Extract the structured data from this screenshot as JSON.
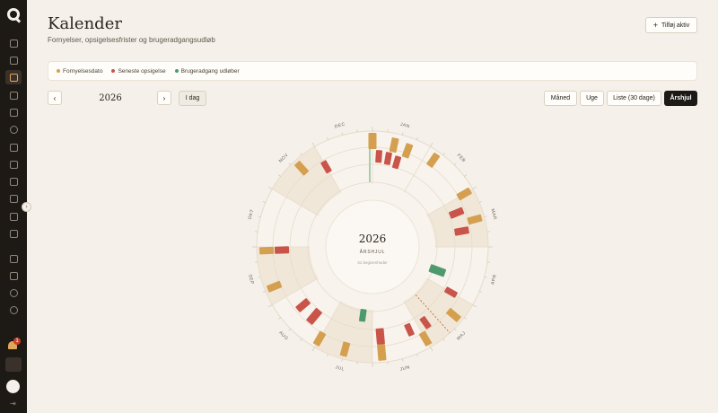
{
  "page": {
    "title": "Kalender",
    "subtitle": "Fornyelser, opsigelsesfrister og brugeradgangsudløb"
  },
  "add_button": {
    "icon": "plus-icon",
    "label": "Tilføj aktiv"
  },
  "legend": [
    {
      "label": "Fornyelsesdato",
      "color": "#d4a050"
    },
    {
      "label": "Seneste opsigelse",
      "color": "#c8544a"
    },
    {
      "label": "Brugeradgang udløber",
      "color": "#4f9a6c"
    }
  ],
  "nav": {
    "prev": "‹",
    "next": "›",
    "year": "2026",
    "today": "I dag"
  },
  "views": [
    {
      "label": "Måned",
      "active": false
    },
    {
      "label": "Uge",
      "active": false
    },
    {
      "label": "Liste (30 dage)",
      "active": false
    },
    {
      "label": "Årshjul",
      "active": true
    }
  ],
  "wheel": {
    "center_year": "2026",
    "center_label": "ÅRSHJUL",
    "center_caption": "31 begivenheder",
    "months": [
      "JAN",
      "FEB",
      "MAR",
      "APR",
      "MAJ",
      "JUN",
      "JUL",
      "AUG",
      "SEP",
      "OKT",
      "NOV",
      "DEC"
    ]
  },
  "sidebar": {
    "notification_count": "1"
  },
  "colors": {
    "renewal": "#d4a050",
    "cancellation": "#c8544a",
    "access": "#4f9a6c",
    "background": "#f5f1ea",
    "sidebar": "#1d1a16"
  }
}
